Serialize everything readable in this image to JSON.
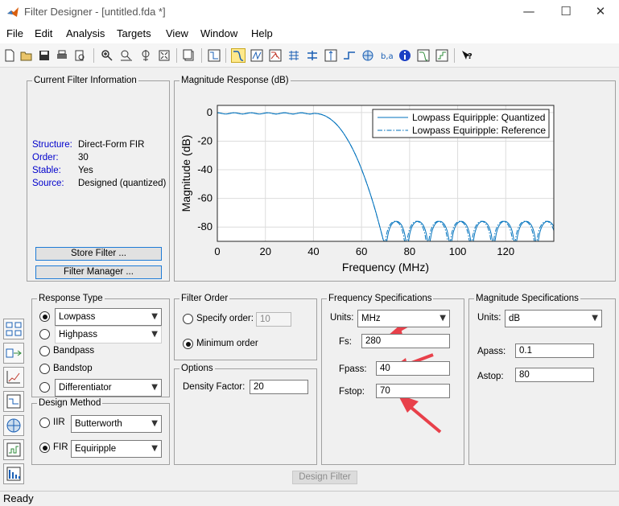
{
  "window": {
    "title": "Filter Designer - [untitled.fda *]",
    "minimize": "—",
    "maximize": "☐",
    "close": "✕"
  },
  "menu": [
    "File",
    "Edit",
    "Analysis",
    "Targets",
    "View",
    "Window",
    "Help"
  ],
  "toolbar_icons": [
    "new-icon",
    "open-icon",
    "save-icon",
    "print-icon",
    "print-preview-icon",
    "zoom-in-icon",
    "zoom-x-icon",
    "zoom-y-icon",
    "full-view-icon",
    "new-figure-icon",
    "filter-spec-icon",
    "magnitude-response-icon",
    "phase-response-icon",
    "magnitude-phase-icon",
    "group-delay-icon",
    "phase-delay-icon",
    "impulse-response-icon",
    "step-response-icon",
    "pole-zero-icon",
    "filter-coefficients-icon",
    "filter-info-icon",
    "magnitude-response-estimate-icon",
    "round-off-noise-icon",
    "whats-this-icon"
  ],
  "current_filter": {
    "title": "Current Filter Information",
    "rows": [
      {
        "label": "Structure:",
        "value": "Direct-Form FIR"
      },
      {
        "label": "Order:",
        "value": "30"
      },
      {
        "label": "Stable:",
        "value": "Yes"
      },
      {
        "label": "Source:",
        "value": "Designed (quantized)"
      }
    ],
    "store_button": "Store Filter ...",
    "manager_button": "Filter Manager ..."
  },
  "magnitude": {
    "title": "Magnitude Response (dB)"
  },
  "chart_data": {
    "type": "line",
    "xlabel": "Frequency (MHz)",
    "ylabel": "Magnitude (dB)",
    "xlim": [
      0,
      140
    ],
    "ylim": [
      -90,
      5
    ],
    "xticks": [
      "0",
      "20",
      "40",
      "60",
      "80",
      "100",
      "120"
    ],
    "yticks": [
      "0",
      "-20",
      "-40",
      "-60",
      "-80"
    ],
    "grid": true,
    "legend_position": "top-right",
    "series": [
      {
        "name": "Lowpass Equiripple: Quantized",
        "style": "solid",
        "color": "#0072bd"
      },
      {
        "name": "Lowpass Equiripple: Reference",
        "style": "dashdot",
        "color": "#0072bd"
      }
    ],
    "passband_edge": 40,
    "stopband_edge": 70,
    "stopband_level": -76
  },
  "response_type": {
    "title": "Response Type",
    "options": [
      {
        "label": "Lowpass",
        "selected": true,
        "has_select": true
      },
      {
        "label": "Highpass",
        "selected": false,
        "has_select": true
      },
      {
        "label": "Bandpass",
        "selected": false
      },
      {
        "label": "Bandstop",
        "selected": false
      },
      {
        "label": "Differentiator",
        "selected": false,
        "has_select": true
      }
    ]
  },
  "design_method": {
    "title": "Design Method",
    "iir_label": "IIR",
    "iir_value": "Butterworth",
    "fir_label": "FIR",
    "fir_value": "Equiripple",
    "selected": "FIR"
  },
  "filter_order": {
    "title": "Filter Order",
    "specify_label": "Specify order:",
    "specify_value": "10",
    "minimum_label": "Minimum order",
    "selected": "minimum"
  },
  "options": {
    "title": "Options",
    "density_label": "Density Factor:",
    "density_value": "20"
  },
  "freq_specs": {
    "title": "Frequency Specifications",
    "units_label": "Units:",
    "units_value": "MHz",
    "fs_label": "Fs:",
    "fs_value": "280",
    "fpass_label": "Fpass:",
    "fpass_value": "40",
    "fstop_label": "Fstop:",
    "fstop_value": "70"
  },
  "mag_specs": {
    "title": "Magnitude Specifications",
    "units_label": "Units:",
    "units_value": "dB",
    "apass_label": "Apass:",
    "apass_value": "0.1",
    "astop_label": "Astop:",
    "astop_value": "80"
  },
  "design_button": "Design Filter",
  "status": "Ready",
  "colors": {
    "accent": "#1e7bd6",
    "trace": "#0072bd",
    "annotation": "#e8404a",
    "label_blue": "#0000cc"
  }
}
